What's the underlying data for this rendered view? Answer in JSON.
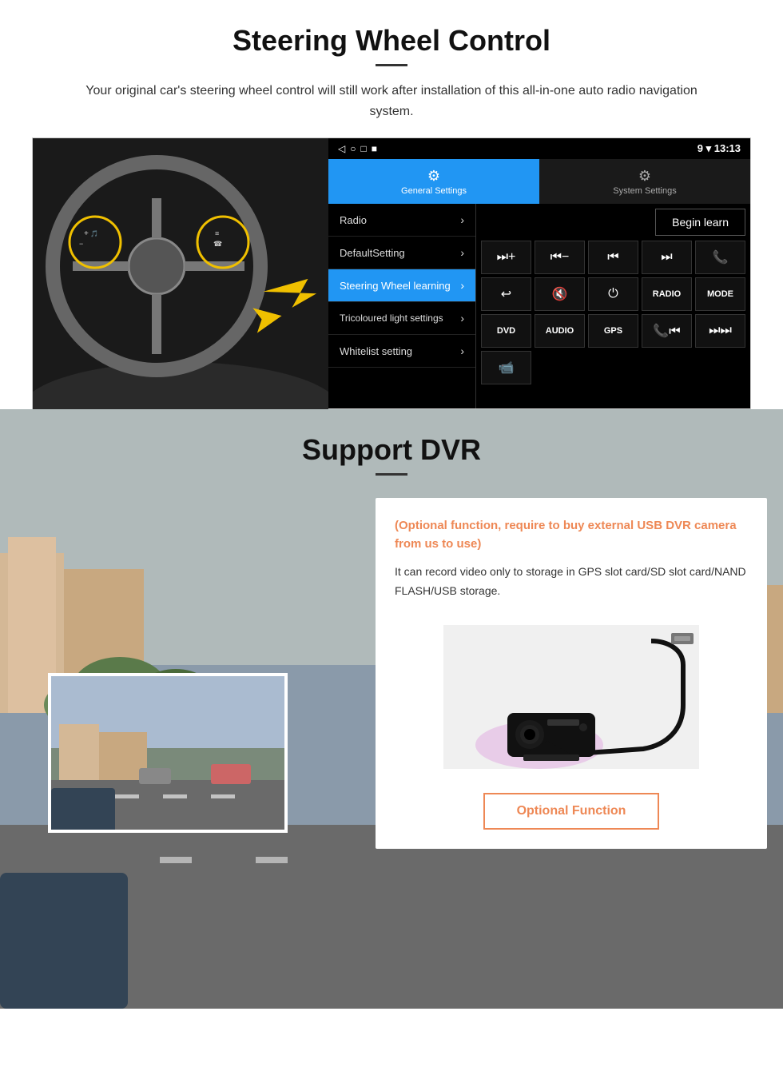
{
  "steering": {
    "title": "Steering Wheel Control",
    "description": "Your original car's steering wheel control will still work after installation of this all-in-one auto radio navigation system.",
    "statusbar": {
      "icons": [
        "◁",
        "○",
        "□",
        "■"
      ],
      "time": "13:13",
      "wifi": "▾",
      "signal": "9"
    },
    "tabs": {
      "general_label": "General Settings",
      "system_label": "System Settings",
      "general_icon": "⚙",
      "system_icon": "⚙"
    },
    "menu": [
      {
        "label": "Radio",
        "active": false
      },
      {
        "label": "DefaultSetting",
        "active": false
      },
      {
        "label": "Steering Wheel learning",
        "active": true
      },
      {
        "label": "Tricoloured light settings",
        "active": false
      },
      {
        "label": "Whitelist setting",
        "active": false
      }
    ],
    "begin_learn_label": "Begin learn",
    "controls": [
      "⏭+",
      "⏮−",
      "⏮⏮",
      "⏭⏭",
      "📞",
      "↩",
      "🔇×",
      "⏻",
      "RADIO",
      "MODE",
      "DVD",
      "AUDIO",
      "GPS",
      "📞⏮",
      "⏭⏭"
    ],
    "dvd_icon": "📀"
  },
  "dvr": {
    "title": "Support DVR",
    "optional_text": "(Optional function, require to buy external USB DVR camera from us to use)",
    "description": "It can record video only to storage in GPS slot card/SD slot card/NAND FLASH/USB storage.",
    "optional_button_label": "Optional Function"
  }
}
